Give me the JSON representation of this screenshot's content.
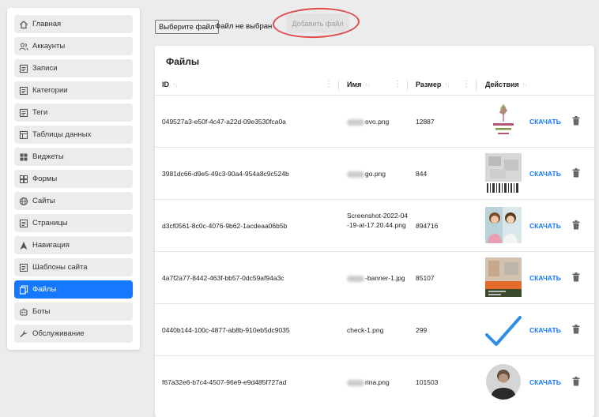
{
  "sidebar": {
    "items": [
      {
        "label": "Главная",
        "icon": "home-icon"
      },
      {
        "label": "Аккаунты",
        "icon": "users-icon"
      },
      {
        "label": "Записи",
        "icon": "document-icon"
      },
      {
        "label": "Категории",
        "icon": "document-icon"
      },
      {
        "label": "Теги",
        "icon": "document-icon"
      },
      {
        "label": "Таблицы данных",
        "icon": "table-icon"
      },
      {
        "label": "Виджеты",
        "icon": "widgets-icon"
      },
      {
        "label": "Формы",
        "icon": "forms-icon"
      },
      {
        "label": "Сайты",
        "icon": "globe-icon"
      },
      {
        "label": "Страницы",
        "icon": "document-icon"
      },
      {
        "label": "Навигация",
        "icon": "navigation-icon"
      },
      {
        "label": "Шаблоны сайта",
        "icon": "document-icon"
      },
      {
        "label": "Файлы",
        "icon": "files-icon",
        "active": true
      },
      {
        "label": "Боты",
        "icon": "bot-icon"
      },
      {
        "label": "Обслуживание",
        "icon": "wrench-icon"
      }
    ]
  },
  "upload": {
    "choose_label": "Выберите файл",
    "status": "Файл не выбран",
    "add_label": "Добавить файл"
  },
  "files": {
    "title": "Файлы",
    "columns": [
      "ID",
      "Имя",
      "Размер",
      "Действия"
    ],
    "download_label": "СКАЧАТЬ",
    "rows": [
      {
        "id": "049527a3-e50f-4c47-a22d-09e3530fca0a",
        "name": "ovo.png",
        "size": "12887"
      },
      {
        "id": "3981dc66-d9e5-49c3-90a4-954a8c9c524b",
        "name": "go.png",
        "size": "844"
      },
      {
        "id": "d3cf0561-8c0c-4076-9b62-1acdeaa06b5b",
        "name": "Screenshot-2022-04-19-at-17.20.44.png",
        "size": "894716"
      },
      {
        "id": "4a7f2a77-8442-463f-bb57-0dc59af94a3c",
        "name": "-banner-1.jpg",
        "size": "85107"
      },
      {
        "id": "0440b144-100c-4877-ab8b-910eb5dc9035",
        "name": "check-1.png",
        "size": "299"
      },
      {
        "id": "f67a32e6-b7c4-4507-96e9-e9d485f727ad",
        "name": "rina.png",
        "size": "101503"
      }
    ]
  },
  "colors": {
    "accent": "#1677ff",
    "highlight": "#e24a4a"
  }
}
